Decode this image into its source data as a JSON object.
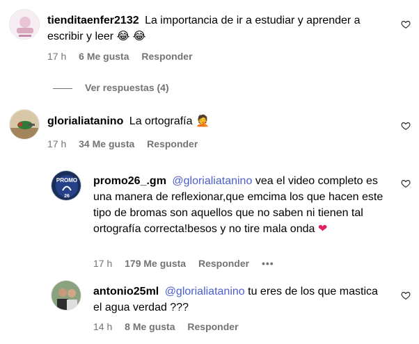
{
  "comments": [
    {
      "username": "tienditaenfer2132",
      "mention": "",
      "text": "La importancia de ir a estudiar y aprender a escribir y leer",
      "emoji": "😂 😂",
      "time": "17 h",
      "likes": "6 Me gusta",
      "reply": "Responder"
    },
    {
      "username": "glorialiatanino",
      "mention": "",
      "text": "La ortografía",
      "emoji": "🤦",
      "time": "17 h",
      "likes": "34 Me gusta",
      "reply": "Responder"
    },
    {
      "username": "promo26_.gm",
      "mention": "@glorialiatanino",
      "text": "vea el video completo es una manera de reflexionar,que emcima los que hacen este tipo de bromas son aquellos que no saben ni tienen tal ortografía correcta!besos y no tire mala onda",
      "emoji": "❤",
      "time": "17 h",
      "likes": "179 Me gusta",
      "reply": "Responder",
      "more": "•••"
    },
    {
      "username": "antonio25ml",
      "mention": "@glorialiatanino",
      "text": "tu eres de los que mastica el agua verdad ???",
      "emoji": "",
      "time": "14 h",
      "likes": "8 Me gusta",
      "reply": "Responder"
    }
  ],
  "view_replies": "Ver respuestas (4)",
  "avatars": {
    "promo_logo_top": "PROMO",
    "promo_logo_bottom": "26"
  },
  "icons": {
    "like": "heart-outline-icon"
  }
}
